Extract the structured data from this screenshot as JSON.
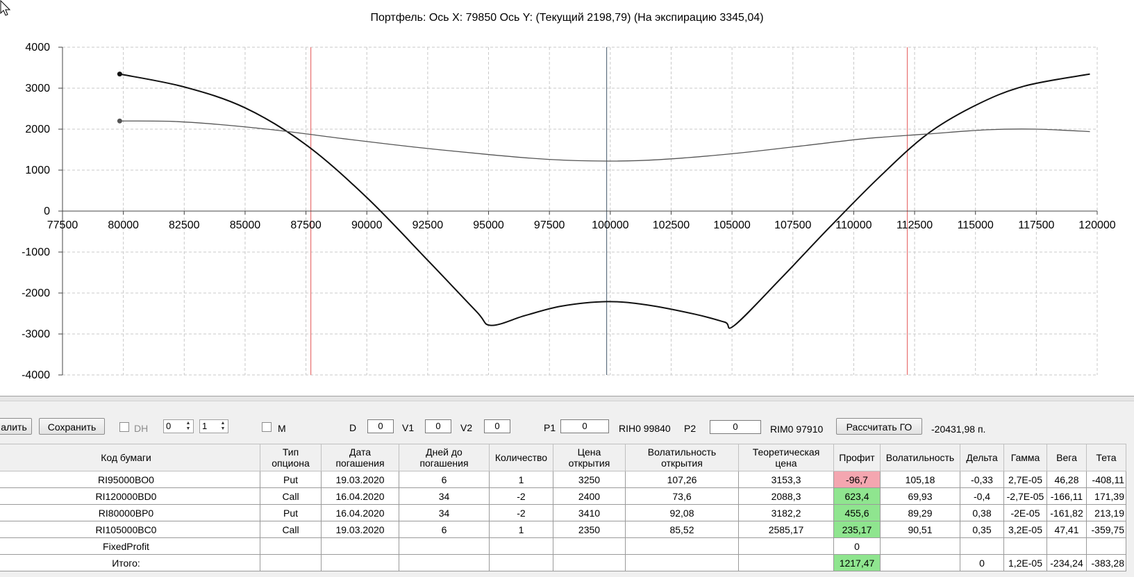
{
  "chart": {
    "title": "Портфель: Ось X: 79850 Ось Y:  (Текущий 2198,79)  (На экспирацию 3345,04)"
  },
  "chart_data": {
    "type": "line",
    "title": "Портфель: Ось X: 79850 Ось Y:  (Текущий 2198,79)  (На экспирацию 3345,04)",
    "xlim": [
      77500,
      120000
    ],
    "ylim": [
      -4000,
      4000
    ],
    "x_ticks": [
      "77500",
      "80000",
      "82500",
      "85000",
      "87500",
      "90000",
      "92500",
      "95000",
      "97500",
      "100000",
      "102500",
      "105000",
      "107500",
      "110000",
      "112500",
      "115000",
      "117500",
      "120000"
    ],
    "y_ticks": [
      "4000",
      "3000",
      "2000",
      "1000",
      "0",
      "-1000",
      "-2000",
      "-3000",
      "-4000"
    ],
    "grid": true,
    "vertical_markers": [
      {
        "x": 87700,
        "color": "#e87070"
      },
      {
        "x": 99850,
        "color": "#607080"
      },
      {
        "x": 112200,
        "color": "#e87070"
      }
    ],
    "series": [
      {
        "color": "#111111",
        "x": [
          79850,
          82500,
          85000,
          87500,
          90000,
          92500,
          94500,
          95100,
          96500,
          98000,
          99850,
          101500,
          103500,
          104700,
          105100,
          107000,
          109000,
          111000,
          113000,
          115000,
          117000,
          119700
        ],
        "y": [
          3345,
          3030,
          2520,
          1620,
          330,
          -1200,
          -2450,
          -2790,
          -2550,
          -2320,
          -2210,
          -2290,
          -2520,
          -2710,
          -2790,
          -1650,
          -400,
          800,
          1870,
          2580,
          3050,
          3345
        ]
      },
      {
        "color": "#555555",
        "x": [
          79850,
          82000,
          84000,
          86500,
          89000,
          92000,
          95000,
          97500,
          99850,
          102000,
          105000,
          108000,
          110500,
          113000,
          115500,
          117500,
          119700
        ],
        "y": [
          2199,
          2190,
          2110,
          1960,
          1770,
          1560,
          1380,
          1260,
          1220,
          1255,
          1400,
          1600,
          1770,
          1880,
          1985,
          2000,
          1940
        ]
      }
    ],
    "endpoints": [
      {
        "x": 79850,
        "y": 3345
      },
      {
        "x": 79850,
        "y": 2199
      }
    ]
  },
  "toolbar": {
    "delete_label": "алить",
    "save_label": "Сохранить",
    "dh_label": "DH",
    "spin1_value": "0",
    "spin2_value": "1",
    "m_label": "M",
    "d_label": "D",
    "d_value": "0",
    "v1_label": "V1",
    "v1_value": "0",
    "v2_label": "V2",
    "v2_value": "0",
    "p1_label": "P1",
    "p1_value": "0",
    "rih_label": "RIH0 99840",
    "p2_label": "P2",
    "p2_value": "0",
    "rim_label": "RIM0 97910",
    "calc_label": "Рассчитать ГО",
    "go_value": "-20431,98 п."
  },
  "table": {
    "headers": [
      "Код бумаги",
      "Тип\nопциона",
      "Дата\nпогашения",
      "Дней до\nпогашения",
      "Количество",
      "Цена\nоткрытия",
      "Волатильность\nоткрытия",
      "Теоретическая\nцена",
      "Профит",
      "Волатильность",
      "Дельта",
      "Гамма",
      "Вега",
      "Тета"
    ],
    "rows": [
      [
        "RI95000BO0",
        "Put",
        "19.03.2020",
        "6",
        "1",
        "3250",
        "107,26",
        "3153,3",
        "-96,7",
        "105,18",
        "-0,33",
        "2,7E-05",
        "46,28",
        "-408,11"
      ],
      [
        "RI120000BD0",
        "Call",
        "16.04.2020",
        "34",
        "-2",
        "2400",
        "73,6",
        "2088,3",
        "623,4",
        "69,93",
        "-0,4",
        "-2,7E-05",
        "-166,11",
        "171,39"
      ],
      [
        "RI80000BP0",
        "Put",
        "16.04.2020",
        "34",
        "-2",
        "3410",
        "92,08",
        "3182,2",
        "455,6",
        "89,29",
        "0,38",
        "-2E-05",
        "-161,82",
        "213,19"
      ],
      [
        "RI105000BC0",
        "Call",
        "19.03.2020",
        "6",
        "1",
        "2350",
        "85,52",
        "2585,17",
        "235,17",
        "90,51",
        "0,35",
        "3,2E-05",
        "47,41",
        "-359,75"
      ],
      [
        "FixedProfit",
        "",
        "",
        "",
        "",
        "",
        "",
        "",
        "0",
        "",
        "",
        "",
        "",
        ""
      ],
      [
        "Итого:",
        "",
        "",
        "",
        "",
        "",
        "",
        "",
        "1217,47",
        "",
        "0",
        "1,2E-05",
        "-234,24",
        "-383,28"
      ]
    ],
    "profit_colors": {
      "neg": "#f4a6b0",
      "pos": "#8fe58f"
    }
  }
}
